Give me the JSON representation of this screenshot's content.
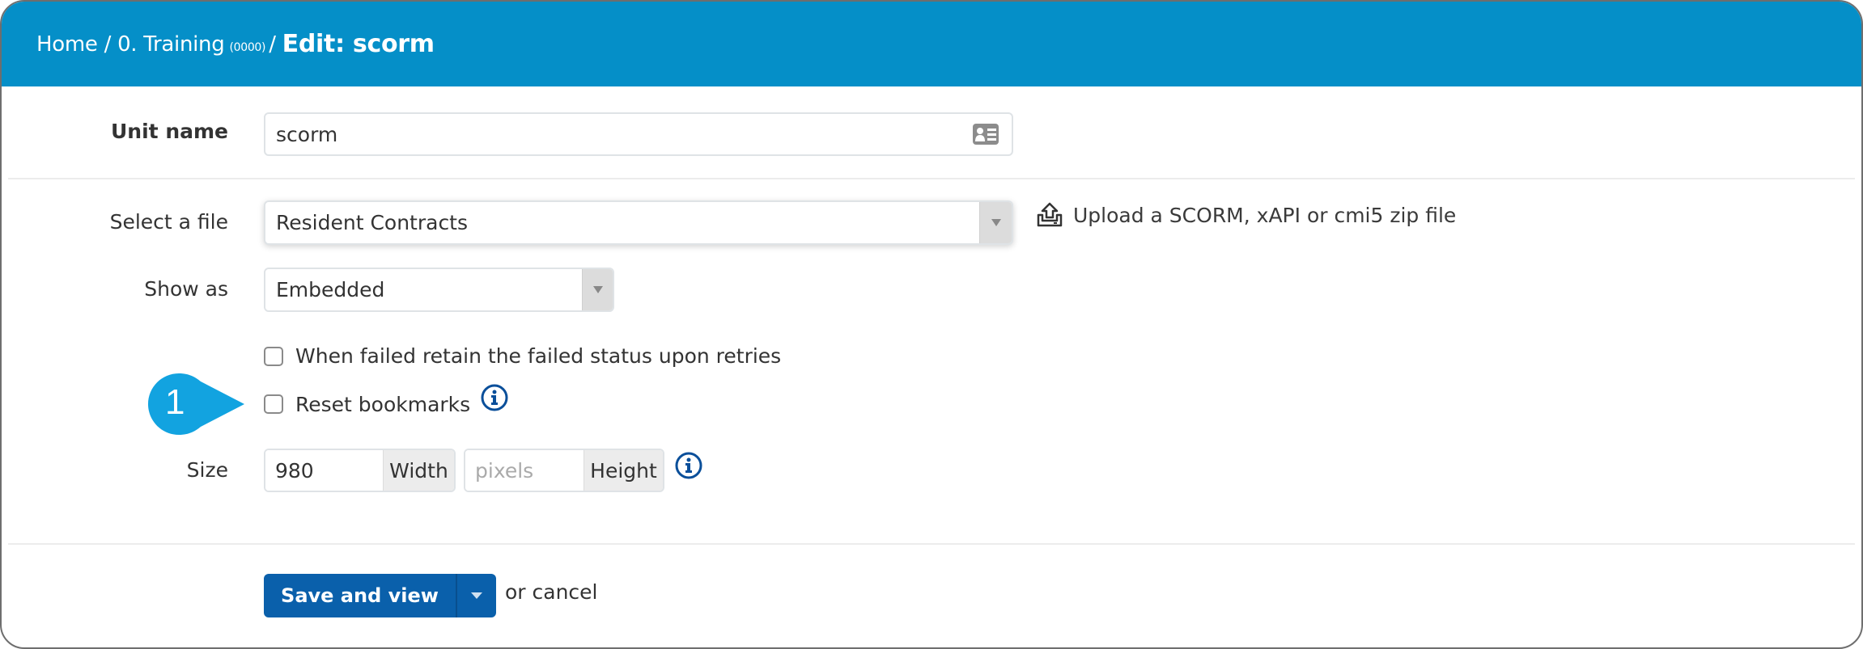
{
  "header": {
    "breadcrumb": [
      {
        "label": "Home"
      },
      {
        "label": "0. Training",
        "suffix": "(0000)"
      }
    ],
    "separator": "/",
    "current": "Edit: scorm"
  },
  "form": {
    "unit_name": {
      "label": "Unit name",
      "value": "scorm",
      "icon": "address-card-icon"
    },
    "select_file": {
      "label": "Select a file",
      "value": "Resident Contracts",
      "upload_link": "Upload a SCORM, xAPI or cmi5 zip file"
    },
    "show_as": {
      "label": "Show as",
      "value": "Embedded"
    },
    "checkboxes": [
      {
        "label": "When failed retain the failed status upon retries",
        "checked": false
      },
      {
        "label": "Reset bookmarks",
        "checked": false
      }
    ],
    "size": {
      "label": "Size",
      "width_value": "980",
      "width_addon": "Width",
      "height_placeholder": "pixels",
      "height_addon": "Height"
    }
  },
  "actions": {
    "save_label": "Save and view",
    "cancel_label": "or cancel"
  },
  "callout": {
    "number": "1"
  },
  "colors": {
    "header": "#058fc8",
    "primary_button": "#0a60ab",
    "callout": "#12a3e0",
    "info_icon": "#0a4f9a"
  }
}
